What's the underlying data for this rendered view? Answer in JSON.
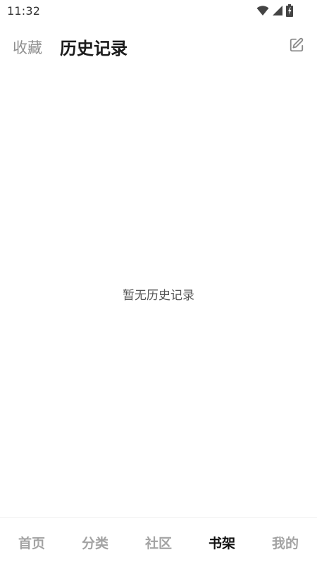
{
  "status_bar": {
    "time": "11:32",
    "icons": [
      "wifi-icon",
      "signal-icon",
      "battery-icon"
    ]
  },
  "header": {
    "tab_favorites": "收藏",
    "tab_history": "历史记录",
    "active_tab": "历史记录",
    "edit_icon": "edit-icon"
  },
  "main": {
    "empty_message": "暂无历史记录"
  },
  "bottom_nav": {
    "items": [
      {
        "label": "首页"
      },
      {
        "label": "分类"
      },
      {
        "label": "社区"
      },
      {
        "label": "书架"
      },
      {
        "label": "我的"
      }
    ],
    "active_label": "书架"
  },
  "colors": {
    "active_text": "#1b1b1b",
    "inactive_text": "#a3a3a3",
    "background": "#ffffff"
  }
}
